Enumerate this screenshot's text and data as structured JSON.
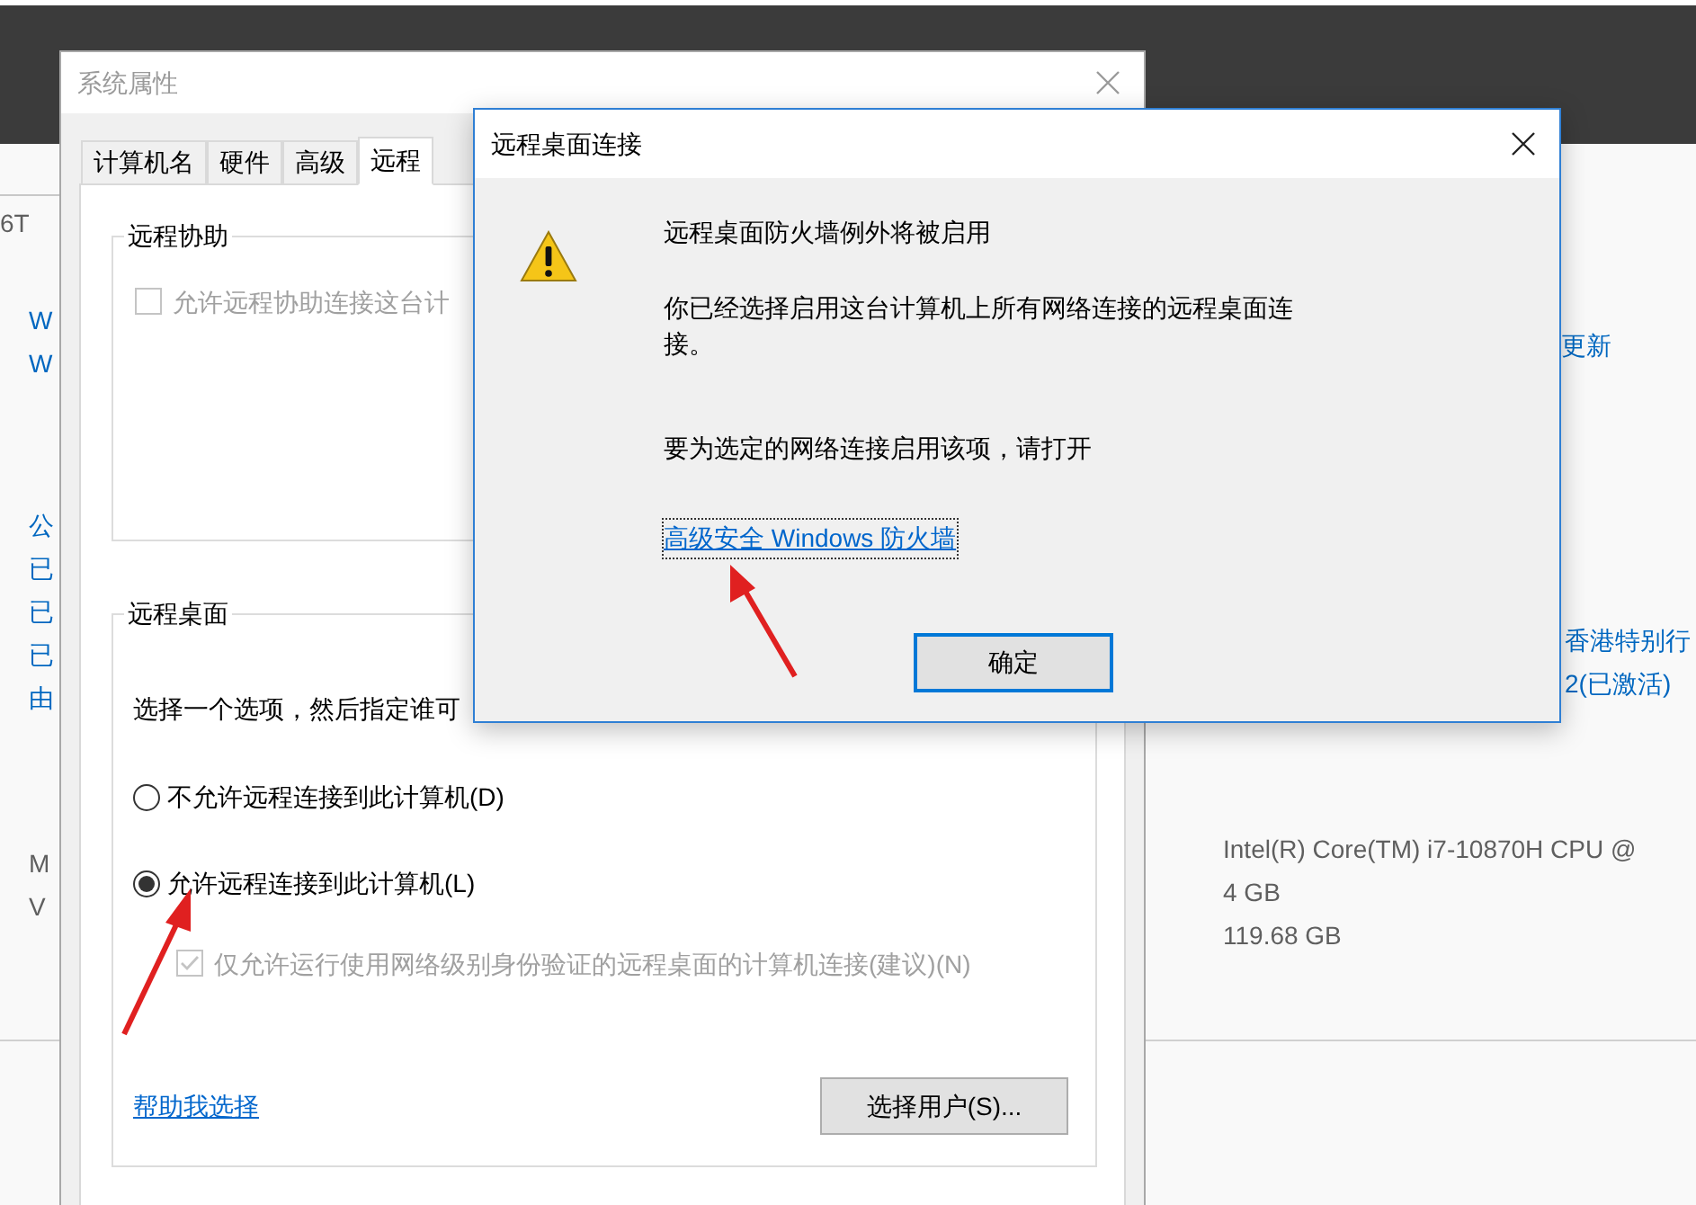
{
  "background_page": {
    "left_groups": [
      [
        {
          "text": "6T",
          "kind": "plain"
        }
      ],
      [
        {
          "text": "W",
          "kind": "link"
        },
        {
          "text": "W",
          "kind": "link"
        }
      ],
      [
        {
          "text": "公",
          "kind": "link"
        },
        {
          "text": "已",
          "kind": "link"
        },
        {
          "text": "已",
          "kind": "link"
        },
        {
          "text": "已",
          "kind": "link"
        },
        {
          "text": "由",
          "kind": "link"
        }
      ],
      [
        {
          "text": "M",
          "kind": "plain"
        },
        {
          "text": "V",
          "kind": "plain"
        }
      ]
    ],
    "right_groups": [
      [
        {
          "text": "更新",
          "kind": "link"
        }
      ],
      [
        {
          "text": "香港特别行",
          "kind": "link"
        },
        {
          "text": "2(已激活)",
          "kind": "link"
        }
      ],
      [
        {
          "text": "Intel(R) Core(TM) i7-10870H CPU @",
          "kind": "plain"
        },
        {
          "text": "4 GB",
          "kind": "plain"
        },
        {
          "text": "119.68 GB",
          "kind": "plain"
        }
      ]
    ]
  },
  "system_properties": {
    "title": "系统属性",
    "tabs": [
      {
        "label": "计算机名",
        "selected": false
      },
      {
        "label": "硬件",
        "selected": false
      },
      {
        "label": "高级",
        "selected": false
      },
      {
        "label": "远程",
        "selected": true
      }
    ],
    "remote_assistance": {
      "title": "远程协助",
      "checkbox": {
        "label": "允许远程协助连接这台计",
        "checked": false,
        "disabled": true
      }
    },
    "remote_desktop": {
      "title": "远程桌面",
      "instruction": "选择一个选项，然后指定谁可",
      "options": [
        {
          "label": "不允许远程连接到此计算机(D)",
          "selected": false
        },
        {
          "label": "允许远程连接到此计算机(L)",
          "selected": true
        }
      ],
      "nla_checkbox": {
        "label": "仅允许运行使用网络级别身份验证的远程桌面的计算机连接(建议)(N)",
        "checked": true,
        "disabled": true
      },
      "help_link": "帮助我选择",
      "select_users_button": "选择用户(S)..."
    }
  },
  "dialog": {
    "title": "远程桌面连接",
    "heading": "远程桌面防火墙例外将被启用",
    "message": "你已经选择启用这台计算机上所有网络连接的远程桌面连接。",
    "prompt": "要为选定的网络连接启用该项，请打开",
    "link": "高级安全 Windows 防火墙",
    "ok_button": "确定"
  }
}
